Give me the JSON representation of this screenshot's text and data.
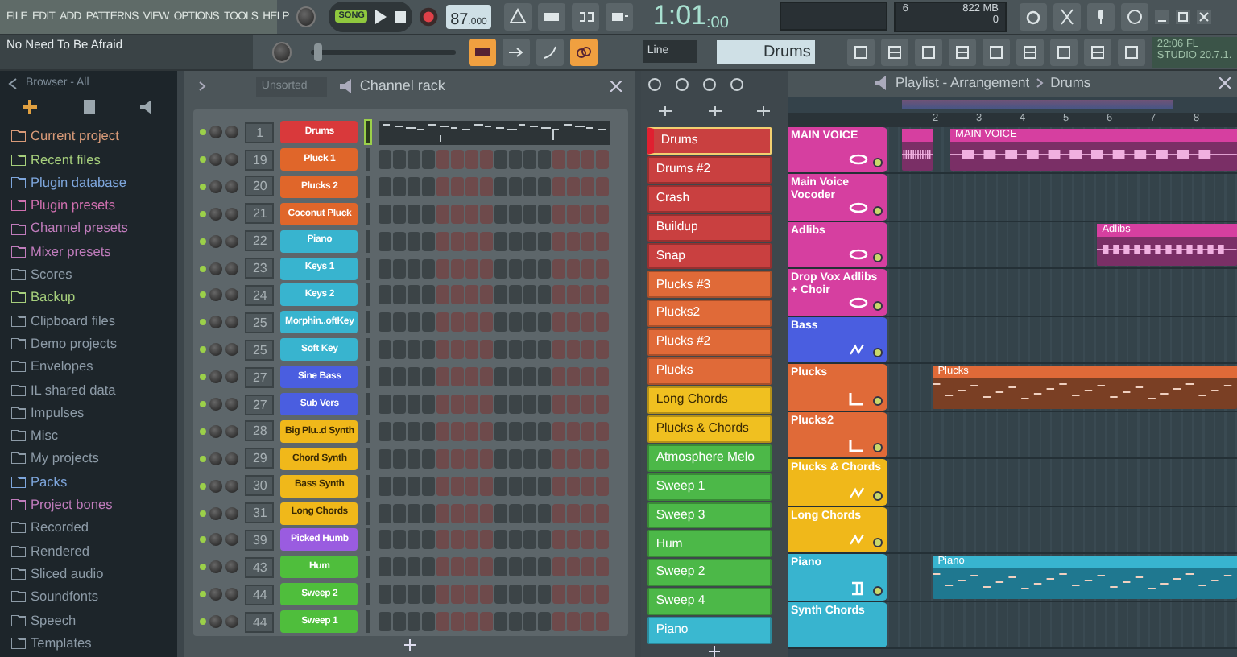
{
  "menu": [
    "FILE",
    "EDIT",
    "ADD",
    "PATTERNS",
    "VIEW",
    "OPTIONS",
    "TOOLS",
    "HELP"
  ],
  "song_title": "No Need To Be Afraid",
  "transport": {
    "mode": "SONG",
    "position": {
      "level": 0.02
    },
    "tempo": "87",
    "tempo_fraction": ".000",
    "time": "1:01",
    "time_fraction": ":00"
  },
  "monitor": {
    "voices": "6",
    "memory": "822 MB",
    "polyphony": "0"
  },
  "mode_toggles": [
    {
      "on": true
    },
    {
      "on": false
    },
    {
      "on": false
    },
    {
      "on": true
    }
  ],
  "snap": "Line",
  "pattern_selector": "Drums",
  "hint": [
    "22:06 FL",
    "STUDIO 20.7.1."
  ],
  "browser": {
    "title": "Browser - All",
    "items": [
      {
        "label": "Current project",
        "color": "#d89a78"
      },
      {
        "label": "Recent files",
        "color": "#a6cf7c"
      },
      {
        "label": "Plugin database",
        "color": "#7ea6dc"
      },
      {
        "label": "Plugin presets",
        "color": "#cf6fae"
      },
      {
        "label": "Channel presets",
        "color": "#c07cbc"
      },
      {
        "label": "Mixer presets",
        "color": "#c07cbc"
      },
      {
        "label": "Scores",
        "color": "#8d9ba7"
      },
      {
        "label": "Backup",
        "color": "#a6cf7c"
      },
      {
        "label": "Clipboard files",
        "color": "#8d9ba7"
      },
      {
        "label": "Demo projects",
        "color": "#8d9ba7"
      },
      {
        "label": "Envelopes",
        "color": "#8d9ba7"
      },
      {
        "label": "IL shared data",
        "color": "#8d9ba7"
      },
      {
        "label": "Impulses",
        "color": "#8d9ba7"
      },
      {
        "label": "Misc",
        "color": "#8d9ba7"
      },
      {
        "label": "My projects",
        "color": "#8d9ba7"
      },
      {
        "label": "Packs",
        "color": "#7ea6dc"
      },
      {
        "label": "Project bones",
        "color": "#c07cbc"
      },
      {
        "label": "Recorded",
        "color": "#8d9ba7"
      },
      {
        "label": "Rendered",
        "color": "#8d9ba7"
      },
      {
        "label": "Sliced audio",
        "color": "#8d9ba7"
      },
      {
        "label": "Soundfonts",
        "color": "#8d9ba7"
      },
      {
        "label": "Speech",
        "color": "#8d9ba7"
      },
      {
        "label": "Templates",
        "color": "#8d9ba7"
      }
    ]
  },
  "channel_rack": {
    "title": "Channel rack",
    "sort": "Unsorted",
    "channels": [
      {
        "number": "1",
        "name": "Drums",
        "color": "#d9393b",
        "kind": "preview",
        "selected": true
      },
      {
        "number": "19",
        "name": "Pluck 1",
        "color": "#e0662a",
        "kind": "steps",
        "selected": false
      },
      {
        "number": "20",
        "name": "Plucks 2",
        "color": "#e0662a",
        "kind": "steps",
        "selected": false
      },
      {
        "number": "21",
        "name": "Coconut Pluck",
        "color": "#e0662a",
        "kind": "steps",
        "selected": false
      },
      {
        "number": "22",
        "name": "Piano",
        "color": "#38b4cf",
        "kind": "steps",
        "selected": false
      },
      {
        "number": "23",
        "name": "Keys 1",
        "color": "#38b4cf",
        "kind": "steps",
        "selected": false
      },
      {
        "number": "24",
        "name": "Keys 2",
        "color": "#38b4cf",
        "kind": "steps",
        "selected": false
      },
      {
        "number": "25",
        "name": "Morphin..oftKey",
        "color": "#38b4cf",
        "kind": "steps",
        "selected": false
      },
      {
        "number": "25",
        "name": "Soft Key",
        "color": "#38b4cf",
        "kind": "steps",
        "selected": false
      },
      {
        "number": "27",
        "name": "Sine Bass",
        "color": "#4a5ee0",
        "kind": "steps",
        "selected": false
      },
      {
        "number": "27",
        "name": "Sub Vers",
        "color": "#4a5ee0",
        "kind": "steps",
        "selected": false
      },
      {
        "number": "28",
        "name": "Big Plu..d Synth",
        "color": "#f0b81a",
        "kind": "steps",
        "selected": false
      },
      {
        "number": "29",
        "name": "Chord Synth",
        "color": "#f0b81a",
        "kind": "steps",
        "selected": false
      },
      {
        "number": "30",
        "name": "Bass Synth",
        "color": "#f0b81a",
        "kind": "steps",
        "selected": false
      },
      {
        "number": "31",
        "name": "Long Chords",
        "color": "#f0b81a",
        "kind": "steps",
        "selected": false
      },
      {
        "number": "39",
        "name": "Picked Humb",
        "color": "#9a5ce0",
        "kind": "steps",
        "selected": false
      },
      {
        "number": "43",
        "name": "Hum",
        "color": "#4fbe3c",
        "kind": "steps",
        "selected": false
      },
      {
        "number": "44",
        "name": "Sweep 2",
        "color": "#4fbe3c",
        "kind": "steps",
        "selected": false
      },
      {
        "number": "44",
        "name": "Sweep 1",
        "color": "#4fbe3c",
        "kind": "steps",
        "selected": false
      }
    ]
  },
  "patterns": [
    {
      "name": "Drums",
      "color": "#c94040",
      "selected": true
    },
    {
      "name": "Drums #2",
      "color": "#c94040",
      "selected": false
    },
    {
      "name": "Crash",
      "color": "#c94040",
      "selected": false
    },
    {
      "name": "Buildup",
      "color": "#c94040",
      "selected": false
    },
    {
      "name": "Snap",
      "color": "#c94040",
      "selected": false
    },
    {
      "name": "Plucks #3",
      "color": "#e06a38",
      "selected": false
    },
    {
      "name": "Plucks2",
      "color": "#e06a38",
      "selected": false
    },
    {
      "name": "Plucks #2",
      "color": "#e06a38",
      "selected": false
    },
    {
      "name": "Plucks",
      "color": "#e06a38",
      "selected": false
    },
    {
      "name": "Long Chords",
      "color": "#f0c020",
      "selected": false
    },
    {
      "name": "Plucks & Chords",
      "color": "#f0c020",
      "selected": false
    },
    {
      "name": "Atmosphere Melo",
      "color": "#4cb848",
      "selected": false
    },
    {
      "name": "Sweep 1",
      "color": "#4cb848",
      "selected": false
    },
    {
      "name": "Sweep 3",
      "color": "#4cb848",
      "selected": false
    },
    {
      "name": "Hum",
      "color": "#4cb848",
      "selected": false
    },
    {
      "name": "Sweep 2",
      "color": "#4cb848",
      "selected": false
    },
    {
      "name": "Sweep 4",
      "color": "#4cb848",
      "selected": false
    },
    {
      "name": "Piano",
      "color": "#3ab8d0",
      "selected": false
    }
  ],
  "playlist": {
    "title": "Playlist - Arrangement",
    "pattern": "Drums",
    "ruler": [
      "2",
      "3",
      "4",
      "5",
      "6",
      "7",
      "8"
    ],
    "tracks": [
      {
        "name": "MAIN VOICE",
        "color": "#d63fa0",
        "kind": "vocal",
        "clips": [
          {
            "kind": "audio"
          },
          {
            "kind": "audio",
            "label": "MAIN VOICE"
          }
        ]
      },
      {
        "name": "Main Voice Vocoder",
        "color": "#d63fa0",
        "kind": "vocal"
      },
      {
        "name": "Adlibs",
        "color": "#d63fa0",
        "kind": "vocal",
        "clips": [
          {
            "kind": "audio",
            "label": "Adlibs"
          }
        ]
      },
      {
        "name": "Drop Vox Adlibs + Choir",
        "color": "#d63fa0",
        "kind": "vocal"
      },
      {
        "name": "Bass",
        "color": "#4a5ee0",
        "kind": "synth"
      },
      {
        "name": "Plucks",
        "color": "#e06a38",
        "kind": "pluck",
        "clips": [
          {
            "kind": "notes",
            "label": "Plucks"
          }
        ]
      },
      {
        "name": "Plucks2",
        "color": "#e06a38",
        "kind": "pluck"
      },
      {
        "name": "Plucks & Chords",
        "color": "#f0b81a",
        "kind": "synth"
      },
      {
        "name": "Long Chords",
        "color": "#f0b81a",
        "kind": "synth"
      },
      {
        "name": "Piano",
        "color": "#38b4cf",
        "kind": "keys",
        "clips": [
          {
            "kind": "notes",
            "label": "Piano"
          }
        ]
      },
      {
        "name": "Synth Chords",
        "color": "#38b4cf"
      }
    ]
  }
}
